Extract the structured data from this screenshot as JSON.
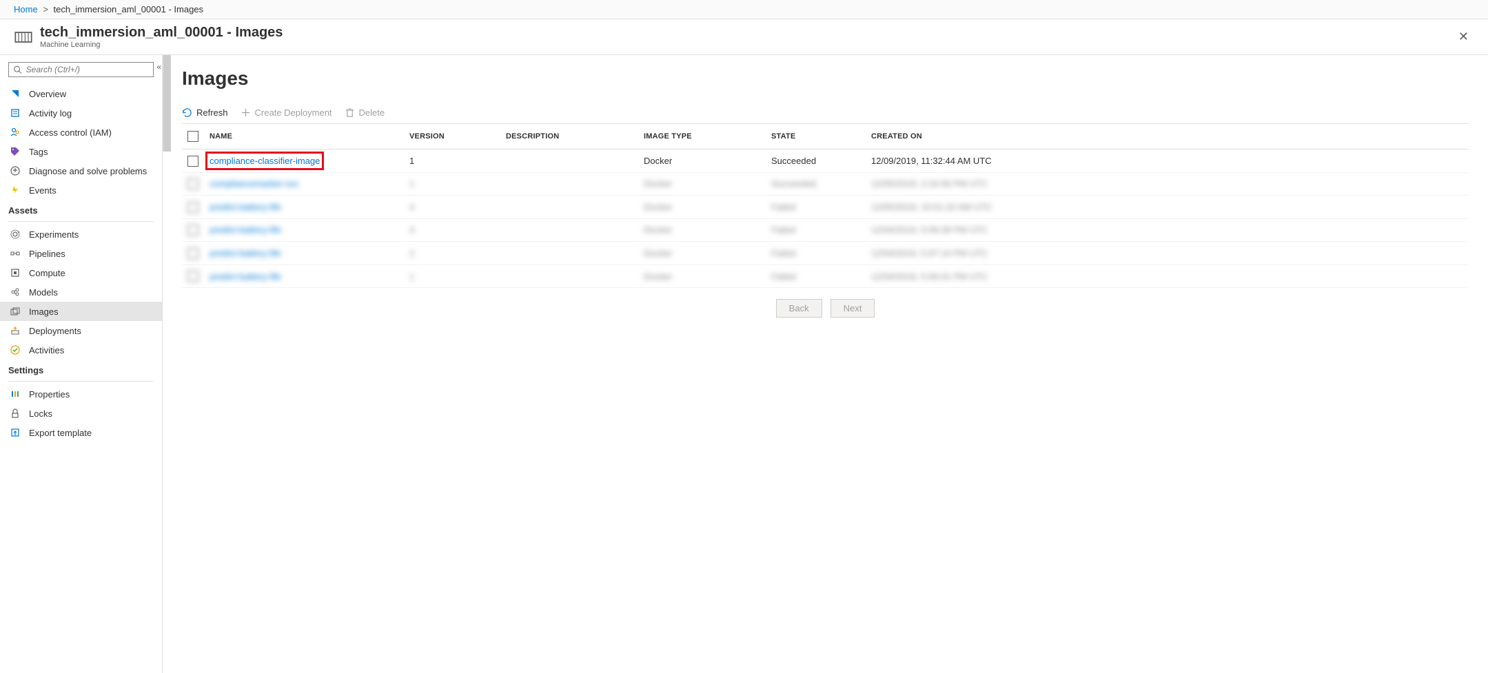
{
  "breadcrumb": {
    "home": "Home",
    "current": "tech_immersion_aml_00001 - Images"
  },
  "header": {
    "title": "tech_immersion_aml_00001 - Images",
    "subtitle": "Machine Learning"
  },
  "search": {
    "placeholder": "Search (Ctrl+/)"
  },
  "nav": {
    "main": [
      {
        "label": "Overview",
        "icon": "overview"
      },
      {
        "label": "Activity log",
        "icon": "activity"
      },
      {
        "label": "Access control (IAM)",
        "icon": "iam"
      },
      {
        "label": "Tags",
        "icon": "tags"
      },
      {
        "label": "Diagnose and solve problems",
        "icon": "diagnose"
      },
      {
        "label": "Events",
        "icon": "events"
      }
    ],
    "sections": [
      {
        "title": "Assets",
        "items": [
          {
            "label": "Experiments",
            "icon": "experiments"
          },
          {
            "label": "Pipelines",
            "icon": "pipelines"
          },
          {
            "label": "Compute",
            "icon": "compute"
          },
          {
            "label": "Models",
            "icon": "models"
          },
          {
            "label": "Images",
            "icon": "images",
            "active": true
          },
          {
            "label": "Deployments",
            "icon": "deployments"
          },
          {
            "label": "Activities",
            "icon": "activities"
          }
        ]
      },
      {
        "title": "Settings",
        "items": [
          {
            "label": "Properties",
            "icon": "properties"
          },
          {
            "label": "Locks",
            "icon": "locks"
          },
          {
            "label": "Export template",
            "icon": "export"
          }
        ]
      }
    ]
  },
  "page": {
    "title": "Images"
  },
  "toolbar": {
    "refresh": "Refresh",
    "create": "Create Deployment",
    "delete": "Delete"
  },
  "table": {
    "headers": {
      "name": "NAME",
      "version": "VERSION",
      "description": "DESCRIPTION",
      "image_type": "IMAGE TYPE",
      "state": "STATE",
      "created_on": "CREATED ON"
    },
    "rows": [
      {
        "name": "compliance-classifier-image",
        "version": "1",
        "description": "",
        "image_type": "Docker",
        "state": "Succeeded",
        "created_on": "12/09/2019, 11:32:44 AM UTC",
        "highlight": true
      },
      {
        "name": "compliancemarker-svc",
        "version": "1",
        "description": "",
        "image_type": "Docker",
        "state": "Succeeded",
        "created_on": "12/05/2019, 2:16:46 PM UTC",
        "blurred": true
      },
      {
        "name": "predict-battery-life",
        "version": "4",
        "description": "",
        "image_type": "Docker",
        "state": "Failed",
        "created_on": "12/05/2019, 10:01:32 AM UTC",
        "blurred": true
      },
      {
        "name": "predict-battery-life",
        "version": "3",
        "description": "",
        "image_type": "Docker",
        "state": "Failed",
        "created_on": "12/04/2019, 5:06:28 PM UTC",
        "blurred": true
      },
      {
        "name": "predict-battery-life",
        "version": "2",
        "description": "",
        "image_type": "Docker",
        "state": "Failed",
        "created_on": "12/04/2019, 5:07:14 PM UTC",
        "blurred": true
      },
      {
        "name": "predict-battery-life",
        "version": "1",
        "description": "",
        "image_type": "Docker",
        "state": "Failed",
        "created_on": "12/04/2019, 5:06:01 PM UTC",
        "blurred": true
      }
    ]
  },
  "pager": {
    "back": "Back",
    "next": "Next"
  }
}
